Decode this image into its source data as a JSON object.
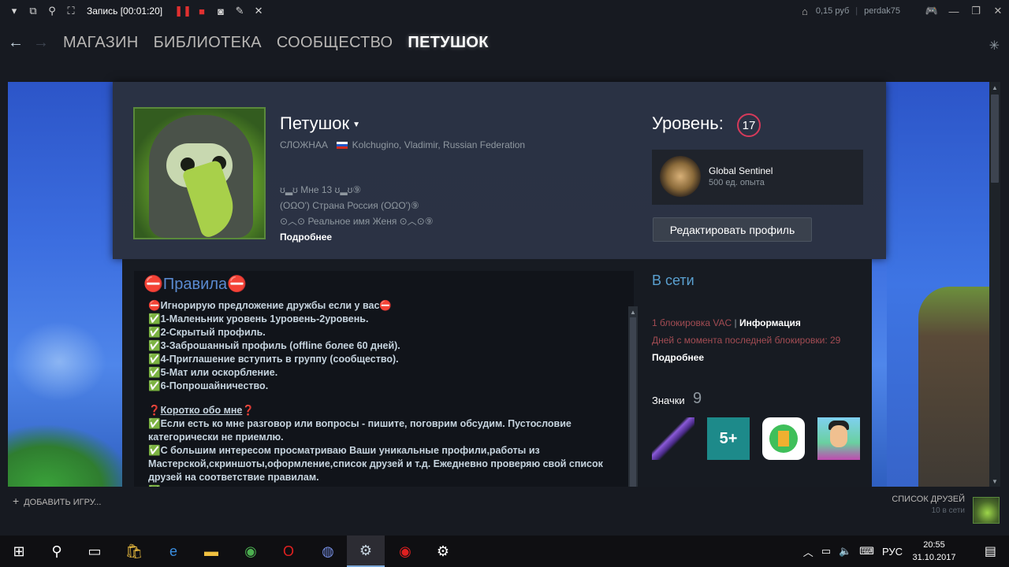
{
  "recorder": {
    "label": "Запись [00:01:20]"
  },
  "account": {
    "balance": "0,15 руб",
    "username": "perdak75"
  },
  "nav": {
    "items": [
      "МАГАЗИН",
      "БИБЛИОТЕКА",
      "СООБЩЕСТВО",
      "ПЕТУШОК"
    ],
    "active_index": 3
  },
  "profile": {
    "persona_name": "Петушок",
    "real_name": "СЛОЖНАА",
    "location": "Kolchugino, Vladimir, Russian Federation",
    "summary_lines": [
      "ʊ▂ʊ Мне 13 ʊ▂ʊ⑨",
      "(ОΩО') Страна Россия (ОΩО')⑨",
      "⊙︿⊙ Реальное имя Женя ⊙︿⊙⑨"
    ],
    "more_link": "Подробнее",
    "level_label": "Уровень:",
    "level": "17",
    "badge_title": "Global Sentinel",
    "badge_xp": "500 ед. опыта",
    "edit_button": "Редактировать профиль"
  },
  "rules": {
    "title": "Правила",
    "lines": [
      "Игнорирую предложение дружбы если у вас",
      "1-Маленьник уровень 1уровень-2уровень.",
      "2-Скрытый профиль.",
      "3-Заброшанный профиль (offline более 60 дней).",
      "4-Приглашение вступить в группу (сообщество).",
      "5-Мат или оскорбление.",
      "6-Попрошайничество."
    ],
    "about_heading": "Коротко обо мне",
    "about_lines": [
      "Если есть ко мне разговор или вопросы - пишите, поговрим обсудим. Пустословие категорически не приемлю.",
      "С большим интересом просматриваю Ваши уникальные профили,работы из Мастерской,скриншоты,оформление,список друзей и т.д. Ежедневно проверяю свой список друзей на соответствие правилам."
    ]
  },
  "status": {
    "online": "В сети",
    "vac_count": "1 блокировка VAC",
    "vac_separator": "|",
    "vac_info": "Информация",
    "ban_days": "Дней с момента последней блокировки: 29",
    "vac_more": "Подробнее",
    "badges_label": "Значки",
    "badges_count": "9",
    "badge_2_text": "5+"
  },
  "bottom": {
    "add_game": "ДОБАВИТЬ ИГРУ...",
    "friends_title": "СПИСОК ДРУЗЕЙ",
    "friends_online": "10 в сети"
  },
  "taskbar": {
    "language": "РУС",
    "time": "20:55",
    "date": "31.10.2017"
  },
  "colors": {
    "steam_bg": "#171a21",
    "profile_panel": "#2a3244",
    "level_ring": "#d53a5a",
    "vac_red": "#a34c53",
    "online_blue": "#5aa0d0",
    "rules_title_blue": "#5a8ad0"
  }
}
